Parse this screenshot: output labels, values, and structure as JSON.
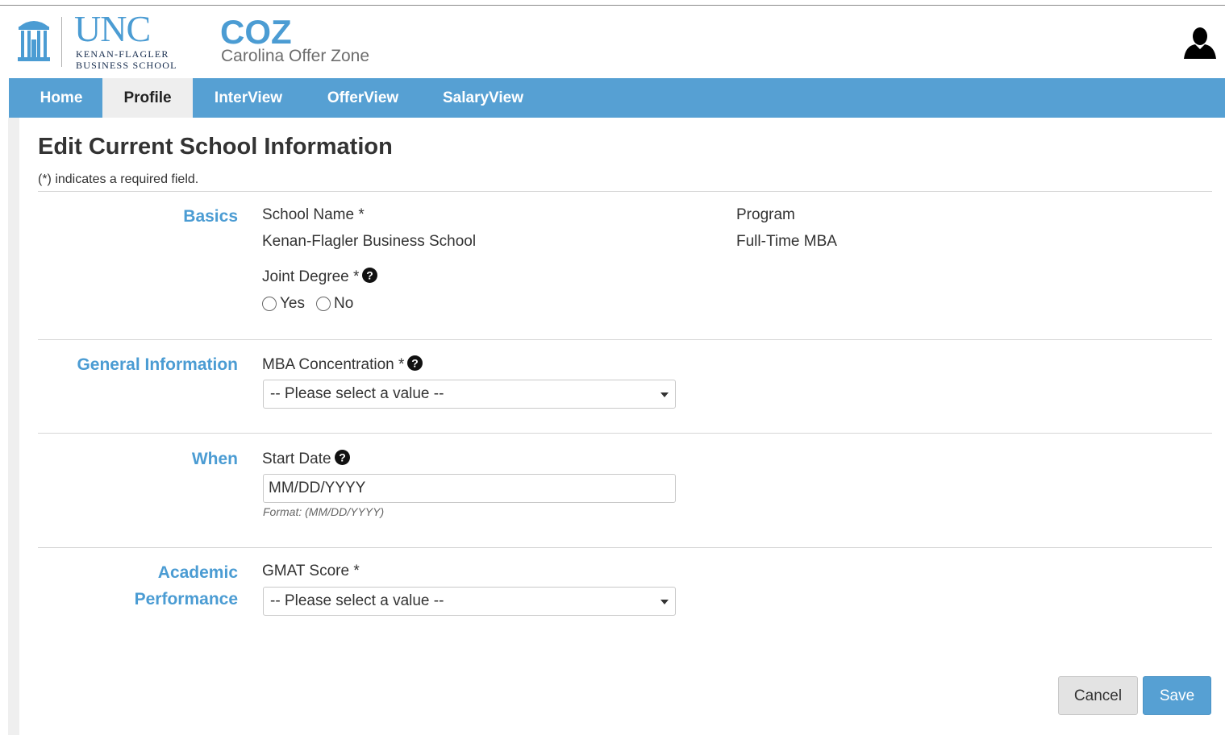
{
  "header": {
    "logo_unc": "UNC",
    "logo_line1": "KENAN-FLAGLER",
    "logo_line2": "BUSINESS SCHOOL",
    "app_name": "COZ",
    "app_subtitle": "Carolina Offer Zone",
    "user_icon": "user-silhouette-icon"
  },
  "nav": {
    "items": [
      {
        "label": "Home",
        "active": false
      },
      {
        "label": "Profile",
        "active": true
      },
      {
        "label": "InterView",
        "active": false
      },
      {
        "label": "OfferView",
        "active": false
      },
      {
        "label": "SalaryView",
        "active": false
      }
    ]
  },
  "page": {
    "title": "Edit Current School Information",
    "required_note": "(*) indicates a required field."
  },
  "sections": {
    "basics": {
      "label": "Basics",
      "school_name_label": "School Name *",
      "school_name_value": "Kenan-Flagler Business School",
      "program_label": "Program",
      "program_value": "Full-Time MBA",
      "joint_degree_label": "Joint Degree *",
      "joint_degree_options": [
        "Yes",
        "No"
      ]
    },
    "general": {
      "label": "General Information",
      "concentration_label": "MBA Concentration *",
      "concentration_value": "-- Please select a value --"
    },
    "when": {
      "label": "When",
      "start_date_label": "Start Date",
      "start_date_placeholder": "MM/DD/YYYY",
      "start_date_format": "Format: (MM/DD/YYYY)"
    },
    "academic": {
      "label_line1": "Academic",
      "label_line2": "Performance",
      "gmat_label": "GMAT Score *",
      "gmat_value": "-- Please select a value --"
    }
  },
  "buttons": {
    "cancel": "Cancel",
    "save": "Save"
  },
  "colors": {
    "brand_blue": "#4b9cd3",
    "nav_blue": "#56a0d3",
    "navy": "#13294b"
  }
}
